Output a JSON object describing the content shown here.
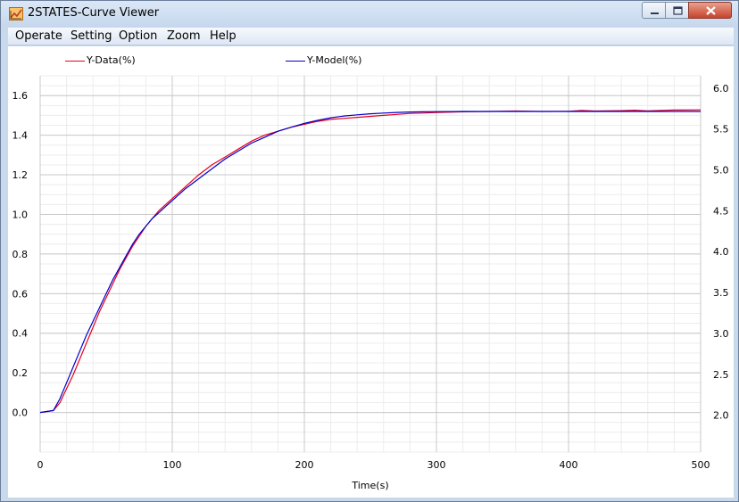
{
  "window": {
    "title": "2STATES-Curve Viewer",
    "app_icon": "chart-app-icon",
    "buttons": {
      "minimize": "minimize-icon",
      "maximize": "maximize-icon",
      "close": "close-icon"
    }
  },
  "menubar": {
    "items": [
      "Operate",
      "Setting",
      "Option",
      "Zoom",
      "Help"
    ]
  },
  "legend": {
    "items": [
      {
        "label": "Y-Data(%)",
        "color": "#e8001c"
      },
      {
        "label": "Y-Model(%)",
        "color": "#0000c8"
      }
    ]
  },
  "colors": {
    "plot_background": "#ffffff",
    "major_grid": "#c8c8c8",
    "minor_grid": "#ececec",
    "data": "#e8001c",
    "model": "#0000c8"
  },
  "chart_data": {
    "type": "line",
    "title": "",
    "xlabel": "Time(s)",
    "ylabel": "",
    "xlim": [
      0,
      500
    ],
    "ylim": [
      -0.2,
      1.7
    ],
    "y2lim": [
      1.55,
      6.15
    ],
    "x_ticks": [
      0,
      100,
      200,
      300,
      400,
      500
    ],
    "x_tick_labels": [
      "0",
      "100",
      "200",
      "300",
      "400",
      "500"
    ],
    "y_ticks": [
      0.0,
      0.2,
      0.4,
      0.6,
      0.8,
      1.0,
      1.2,
      1.4,
      1.6
    ],
    "y_tick_labels": [
      "0.0",
      "0.2",
      "0.4",
      "0.6",
      "0.8",
      "1.0",
      "1.2",
      "1.4",
      "1.6"
    ],
    "y2_ticks": [
      2.0,
      2.5,
      3.0,
      3.5,
      4.0,
      4.5,
      5.0,
      5.5,
      6.0
    ],
    "y2_tick_labels": [
      "2.0",
      "2.5",
      "3.0",
      "3.5",
      "4.0",
      "4.5",
      "5.0",
      "5.5",
      "6.0"
    ],
    "grid": true,
    "legend_position": "top",
    "series": [
      {
        "name": "Y-Data(%)",
        "color": "#e8001c",
        "x": [
          0,
          10,
          15,
          20,
          25,
          30,
          35,
          40,
          45,
          50,
          55,
          60,
          65,
          70,
          75,
          80,
          85,
          90,
          95,
          100,
          110,
          120,
          130,
          140,
          150,
          160,
          170,
          180,
          190,
          200,
          210,
          220,
          230,
          240,
          250,
          260,
          270,
          280,
          290,
          300,
          320,
          340,
          360,
          380,
          400,
          410,
          420,
          440,
          450,
          460,
          480,
          500
        ],
        "y": [
          0.0,
          0.01,
          0.05,
          0.12,
          0.19,
          0.27,
          0.35,
          0.43,
          0.51,
          0.58,
          0.65,
          0.72,
          0.78,
          0.84,
          0.89,
          0.94,
          0.98,
          1.02,
          1.05,
          1.08,
          1.14,
          1.2,
          1.25,
          1.29,
          1.33,
          1.37,
          1.4,
          1.42,
          1.44,
          1.455,
          1.47,
          1.48,
          1.485,
          1.49,
          1.495,
          1.5,
          1.505,
          1.51,
          1.512,
          1.515,
          1.518,
          1.52,
          1.522,
          1.52,
          1.521,
          1.525,
          1.522,
          1.524,
          1.526,
          1.523,
          1.527,
          1.528
        ]
      },
      {
        "name": "Y-Model(%)",
        "color": "#0000c8",
        "x": [
          0,
          10,
          15,
          20,
          25,
          30,
          35,
          40,
          45,
          50,
          55,
          60,
          65,
          70,
          75,
          80,
          85,
          90,
          95,
          100,
          110,
          120,
          130,
          140,
          150,
          160,
          170,
          180,
          190,
          200,
          210,
          220,
          230,
          240,
          250,
          260,
          270,
          280,
          290,
          300,
          320,
          340,
          360,
          380,
          400,
          420,
          440,
          460,
          480,
          500
        ],
        "y": [
          0.0,
          0.01,
          0.07,
          0.15,
          0.23,
          0.31,
          0.39,
          0.46,
          0.53,
          0.6,
          0.67,
          0.73,
          0.79,
          0.85,
          0.9,
          0.94,
          0.98,
          1.01,
          1.04,
          1.07,
          1.13,
          1.18,
          1.23,
          1.28,
          1.32,
          1.36,
          1.39,
          1.42,
          1.44,
          1.46,
          1.475,
          1.488,
          1.497,
          1.503,
          1.508,
          1.512,
          1.515,
          1.517,
          1.518,
          1.519,
          1.52,
          1.52,
          1.52,
          1.52,
          1.52,
          1.52,
          1.52,
          1.52,
          1.52,
          1.52
        ]
      }
    ]
  }
}
